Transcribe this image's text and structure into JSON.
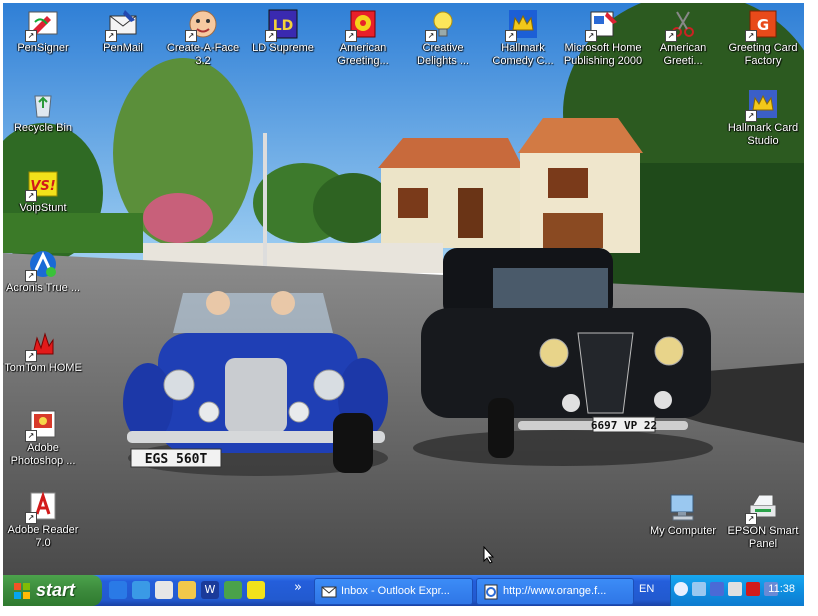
{
  "desktop": {
    "icons": [
      {
        "label": "PenSigner",
        "icon": "pen-signer-icon"
      },
      {
        "label": "PenMail",
        "icon": "pen-mail-icon"
      },
      {
        "label": "Create-A-Face 3.2",
        "icon": "face-icon"
      },
      {
        "label": "LD Supreme",
        "icon": "ld-icon"
      },
      {
        "label": "American Greeting...",
        "icon": "greeting-card-icon"
      },
      {
        "label": "Creative Delights ...",
        "icon": "lightbulb-icon"
      },
      {
        "label": "Hallmark Comedy C...",
        "icon": "crown-icon"
      },
      {
        "label": "Microsoft Home Publishing 2000",
        "icon": "publishing-icon"
      },
      {
        "label": "American Greeti...",
        "icon": "scissors-icon"
      },
      {
        "label": "Greeting Card Factory",
        "icon": "card-factory-icon"
      },
      {
        "label": "Recycle Bin",
        "icon": "recycle-bin-icon"
      },
      {
        "label": "Hallmark Card Studio",
        "icon": "crown-icon"
      },
      {
        "label": "VoipStunt",
        "icon": "voipstunt-icon"
      },
      {
        "label": "Acronis True ...",
        "icon": "acronis-icon"
      },
      {
        "label": "TomTom HOME",
        "icon": "tomtom-icon"
      },
      {
        "label": "Adobe Photoshop ...",
        "icon": "photoshop-icon"
      },
      {
        "label": "Adobe Reader 7.0",
        "icon": "adobe-reader-icon"
      },
      {
        "label": "My Computer",
        "icon": "my-computer-icon"
      },
      {
        "label": "EPSON Smart Panel",
        "icon": "epson-icon"
      }
    ],
    "plate_blue_car": "EGS 560T",
    "plate_black_car": "6697 VP 22"
  },
  "taskbar": {
    "start_label": "start",
    "buttons": [
      {
        "label": "Inbox - Outlook Expr...",
        "icon": "outlook-express-icon"
      },
      {
        "label": "http://www.orange.f...",
        "icon": "internet-explorer-icon"
      }
    ],
    "overflow_label": "»",
    "language": "EN",
    "clock": "11:38"
  },
  "colors": {
    "taskbar": "#245edb",
    "start": "#3c8a3c",
    "tray": "#0f8fe0"
  }
}
